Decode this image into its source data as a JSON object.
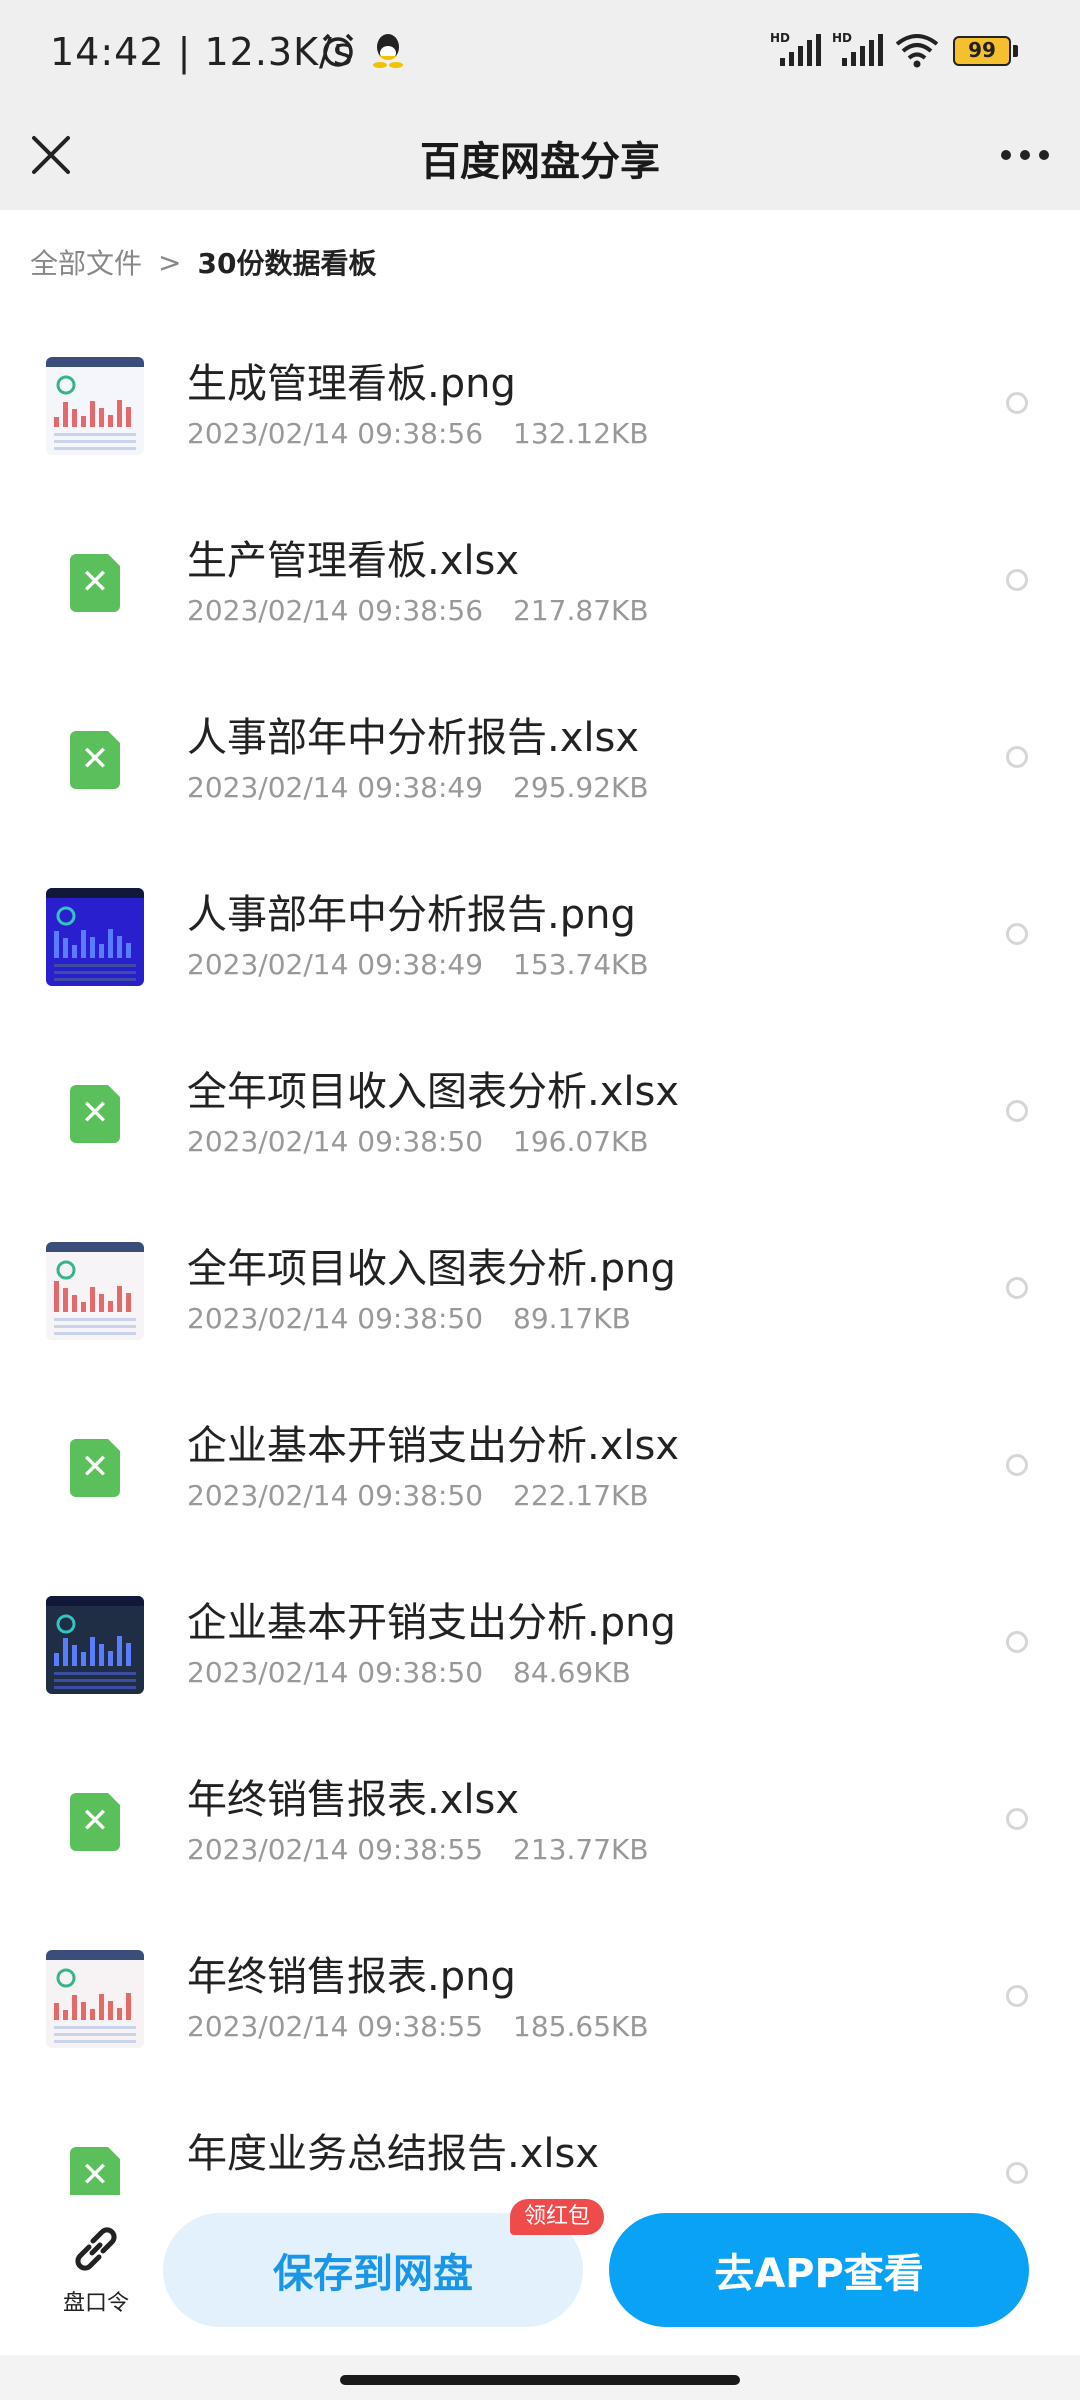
{
  "status_bar": {
    "time": "14:42",
    "net_speed": "12.3K/s",
    "battery": "99"
  },
  "nav": {
    "title": "百度网盘分享"
  },
  "breadcrumb": {
    "root": "全部文件",
    "separator": ">",
    "current": "30份数据看板"
  },
  "files": [
    {
      "name": "生成管理看板.png",
      "date": "2023/02/14 09:38:56",
      "size": "132.12KB",
      "type": "png",
      "thumb_color": "#f4f6fb"
    },
    {
      "name": "生产管理看板.xlsx",
      "date": "2023/02/14 09:38:56",
      "size": "217.87KB",
      "type": "xlsx"
    },
    {
      "name": "人事部年中分析报告.xlsx",
      "date": "2023/02/14 09:38:49",
      "size": "295.92KB",
      "type": "xlsx"
    },
    {
      "name": "人事部年中分析报告.png",
      "date": "2023/02/14 09:38:49",
      "size": "153.74KB",
      "type": "png",
      "thumb_color": "#2a1fcf"
    },
    {
      "name": "全年项目收入图表分析.xlsx",
      "date": "2023/02/14 09:38:50",
      "size": "196.07KB",
      "type": "xlsx"
    },
    {
      "name": "全年项目收入图表分析.png",
      "date": "2023/02/14 09:38:50",
      "size": "89.17KB",
      "type": "png",
      "thumb_color": "#f6f4f6"
    },
    {
      "name": "企业基本开销支出分析.xlsx",
      "date": "2023/02/14 09:38:50",
      "size": "222.17KB",
      "type": "xlsx"
    },
    {
      "name": "企业基本开销支出分析.png",
      "date": "2023/02/14 09:38:50",
      "size": "84.69KB",
      "type": "png",
      "thumb_color": "#1f2d45"
    },
    {
      "name": "年终销售报表.xlsx",
      "date": "2023/02/14 09:38:55",
      "size": "213.77KB",
      "type": "xlsx"
    },
    {
      "name": "年终销售报表.png",
      "date": "2023/02/14 09:38:55",
      "size": "185.65KB",
      "type": "png",
      "thumb_color": "#f7f3f4"
    },
    {
      "name": "年度业务总结报告.xlsx",
      "date": "",
      "size": "",
      "type": "xlsx"
    }
  ],
  "bottom_bar": {
    "link_label": "盘口令",
    "save_label": "保存到网盘",
    "badge_label": "领红包",
    "app_label": "去APP查看"
  },
  "colors": {
    "accent": "#0aa2f5",
    "save_bg": "#e3f1fc",
    "save_text": "#1a96e8",
    "badge_red": "#ef4b4b",
    "xlsx_green": "#5bbf5b"
  }
}
